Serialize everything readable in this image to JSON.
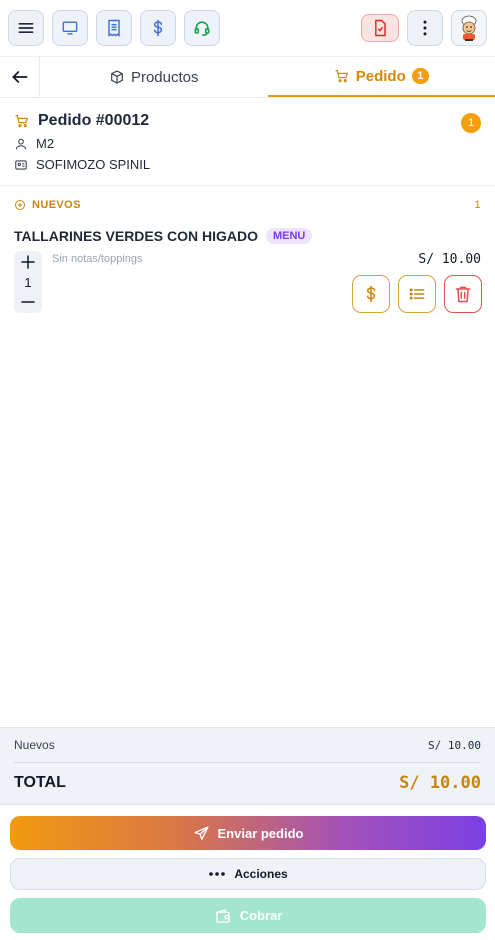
{
  "toolbar": {
    "icons": [
      "menu-icon",
      "monitor-icon",
      "receipt-icon",
      "dollar-icon",
      "headset-icon",
      "pdf-icon",
      "more-vertical-icon",
      "avatar"
    ]
  },
  "tabs": {
    "productos_label": "Productos",
    "pedido_label": "Pedido",
    "pedido_badge": "1"
  },
  "order": {
    "title": "Pedido #00012",
    "count": "1",
    "table": "M2",
    "customer": "SOFIMOZO SPINIL"
  },
  "section": {
    "label": "NUEVOS",
    "count": "1"
  },
  "items": [
    {
      "name": "TALLARINES VERDES CON HIGADO",
      "chip": "MENU",
      "quantity": "1",
      "notes": "Sin notas/toppings",
      "price": "S/ 10.00"
    }
  ],
  "totals": {
    "nuevos_label": "Nuevos",
    "nuevos_value": "S/ 10.00",
    "total_label": "TOTAL",
    "total_value": "S/ 10.00"
  },
  "buttons": {
    "send": "Enviar pedido",
    "acciones": "Acciones",
    "cobrar": "Cobrar"
  },
  "colors": {
    "accent": "#e39a1c",
    "badge": "#f59e0b",
    "menu_chip": "#7c3aed",
    "delete": "#e05252",
    "cobrar": "#a3e5cf"
  }
}
